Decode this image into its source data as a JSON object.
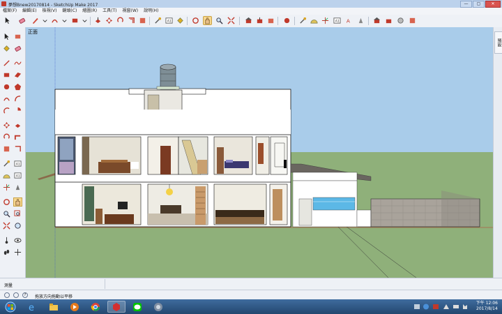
{
  "window": {
    "title": "夢想Bnew20170814 - SketchUp Make 2017",
    "controls": {
      "minimize": "—",
      "maximize": "▢",
      "close": "✕"
    }
  },
  "menu": [
    "檔案(F)",
    "編輯(E)",
    "檢視(V)",
    "鏡頭(C)",
    "繪圖(R)",
    "工具(T)",
    "視窗(W)",
    "說明(H)"
  ],
  "toolbar": {
    "icons": [
      "select-icon",
      "eraser-icon",
      "pencil-icon",
      "arc-icon",
      "rectangle-icon",
      "push-pull-icon",
      "move-icon",
      "rotate-icon",
      "offset-icon",
      "tape-measure-icon",
      "text-icon",
      "paint-bucket-icon",
      "orbit-icon",
      "pan-icon",
      "zoom-icon",
      "zoom-extents-icon",
      "warehouse-icon",
      "extension-icon",
      "component-icon",
      "tape-icon",
      "protractor-icon",
      "text-label-icon",
      "axes-icon",
      "section-icon",
      "warehouse-icon",
      "share-icon",
      "extension-warehouse-icon",
      "layout-icon"
    ]
  },
  "viewport": {
    "view_label": "正面",
    "colors": {
      "sky": "#a9ccea",
      "ground": "#8fb07a",
      "walls": "#ffffff",
      "outline": "#111111",
      "stone_wall": "#a9a39b",
      "pool": "#5cb8e6"
    }
  },
  "right_panel": {
    "tab_label": "預設"
  },
  "measurements": {
    "label": "測量",
    "value": ""
  },
  "status": {
    "hint": "拖放方向拖動以平移",
    "icons": [
      "geo-location-icon",
      "credits-icon",
      "help-icon"
    ]
  },
  "taskbar": {
    "apps": [
      "start-icon",
      "ie-icon",
      "explorer-icon",
      "media-player-icon",
      "chrome-icon",
      "sketchup-icon",
      "line-icon",
      "network-icon"
    ],
    "clock": {
      "time": "下午 12:06",
      "date": "2017/8/14"
    }
  }
}
